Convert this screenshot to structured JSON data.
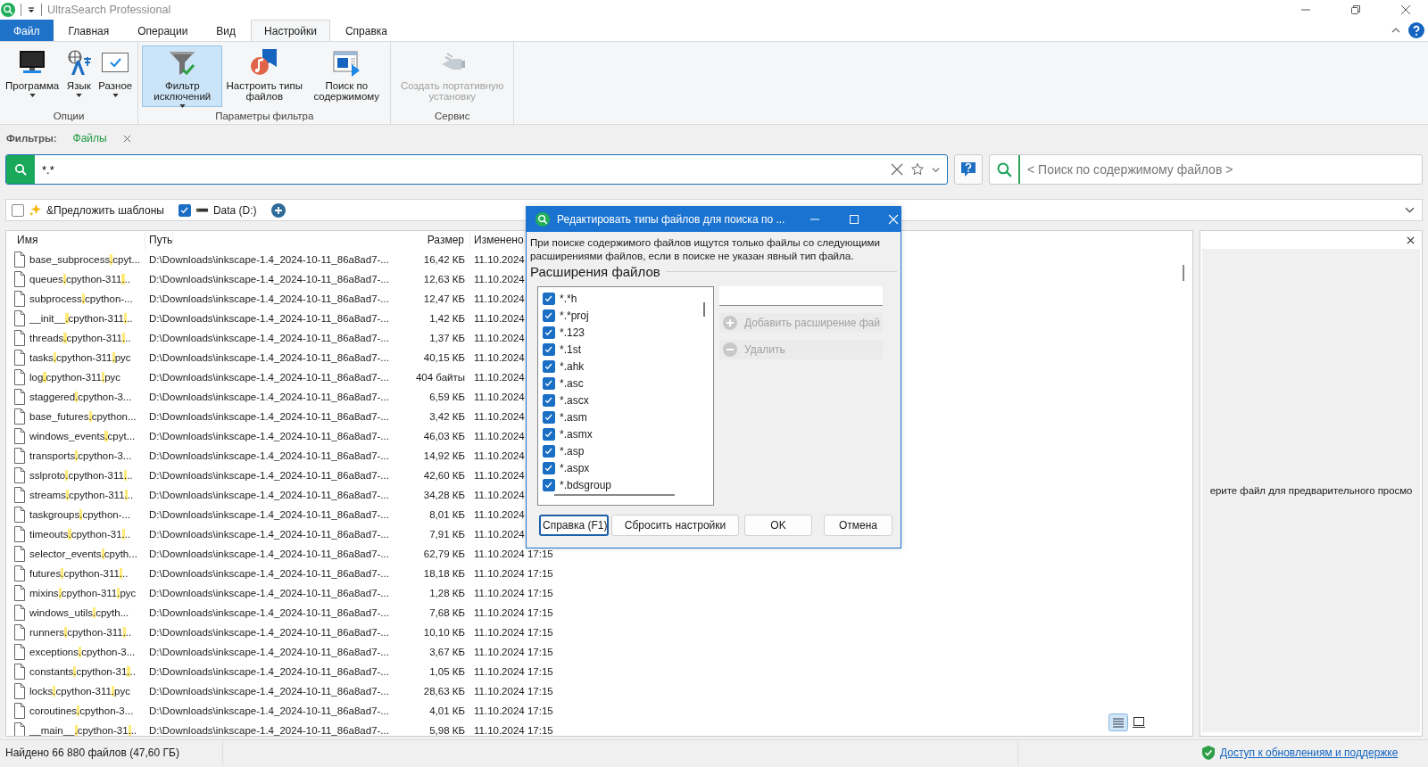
{
  "window": {
    "title": "UltraSearch Professional"
  },
  "ribbon": {
    "tabs": [
      {
        "label": "Файл",
        "kind": "file",
        "selected": false
      },
      {
        "label": "Главная",
        "kind": "tab",
        "selected": false
      },
      {
        "label": "Операции",
        "kind": "tab",
        "selected": false
      },
      {
        "label": "Вид",
        "kind": "tab",
        "selected": false
      },
      {
        "label": "Настройки",
        "kind": "tab",
        "selected": true
      },
      {
        "label": "Справка",
        "kind": "tab",
        "selected": false
      }
    ],
    "groups": [
      {
        "label": "Опции",
        "buttons": [
          {
            "label": "Программа",
            "kind": "monitor",
            "dropdown": true,
            "pressed": false,
            "disabled": false
          },
          {
            "label": "Язык",
            "kind": "language",
            "dropdown": true,
            "pressed": false,
            "disabled": false
          },
          {
            "label": "Разное",
            "kind": "checkwindow",
            "dropdown": true,
            "pressed": false,
            "disabled": false
          }
        ]
      },
      {
        "label": "Параметры фильтра",
        "buttons": [
          {
            "label": "Фильтр исключений",
            "kind": "funnel",
            "dropdown": true,
            "pressed": true,
            "disabled": false
          },
          {
            "label": "Настроить типы файлов",
            "kind": "music",
            "dropdown": false,
            "pressed": false,
            "disabled": false
          },
          {
            "label": "Поиск по содержимому",
            "kind": "content",
            "dropdown": false,
            "pressed": false,
            "disabled": false
          }
        ]
      },
      {
        "label": "Сервис",
        "buttons": [
          {
            "label": "Создать портативную установку",
            "kind": "usb",
            "dropdown": false,
            "pressed": false,
            "disabled": true
          }
        ]
      }
    ]
  },
  "filters": {
    "label": "Фильтры:",
    "tabs": [
      {
        "label": "Файлы"
      }
    ]
  },
  "search": {
    "value": "*.*"
  },
  "content_search": {
    "placeholder": "< Поиск по содержимому файлов >"
  },
  "options": [
    {
      "label": "&Предложить шаблоны",
      "kind": "sparkle",
      "checked": false
    },
    {
      "label": "Data (D:)",
      "kind": "drive",
      "checked": true
    }
  ],
  "table": {
    "columns": [
      "Имя",
      "Путь",
      "Размер",
      "Изменено"
    ],
    "rows": [
      {
        "name": [
          {
            "text": "base_subprocess",
            "match": false
          },
          {
            "text": ".",
            "match": true
          },
          {
            "text": "cpyt...",
            "match": false
          }
        ],
        "path": "D:\\Downloads\\inkscape-1.4_2024-10-11_86a8ad7-...",
        "size": "16,42 КБ",
        "modified": "11.10.2024"
      },
      {
        "name": [
          {
            "text": "queues",
            "match": false
          },
          {
            "text": ".",
            "match": true
          },
          {
            "text": "cpython-311",
            "match": false
          },
          {
            "text": ".",
            "match": true
          },
          {
            "text": "..",
            "match": false
          }
        ],
        "path": "D:\\Downloads\\inkscape-1.4_2024-10-11_86a8ad7-...",
        "size": "12,63 КБ",
        "modified": "11.10.2024"
      },
      {
        "name": [
          {
            "text": "subprocess",
            "match": false
          },
          {
            "text": ".",
            "match": true
          },
          {
            "text": "cpython-...",
            "match": false
          }
        ],
        "path": "D:\\Downloads\\inkscape-1.4_2024-10-11_86a8ad7-...",
        "size": "12,47 КБ",
        "modified": "11.10.2024"
      },
      {
        "name": [
          {
            "text": "__init__",
            "match": false
          },
          {
            "text": ".",
            "match": true
          },
          {
            "text": "cpython-311",
            "match": false
          },
          {
            "text": ".",
            "match": true
          },
          {
            "text": "..",
            "match": false
          }
        ],
        "path": "D:\\Downloads\\inkscape-1.4_2024-10-11_86a8ad7-...",
        "size": "1,42 КБ",
        "modified": "11.10.2024"
      },
      {
        "name": [
          {
            "text": "threads",
            "match": false
          },
          {
            "text": ".",
            "match": true
          },
          {
            "text": "cpython-311",
            "match": false
          },
          {
            "text": ".",
            "match": true
          },
          {
            "text": "..",
            "match": false
          }
        ],
        "path": "D:\\Downloads\\inkscape-1.4_2024-10-11_86a8ad7-...",
        "size": "1,37 КБ",
        "modified": "11.10.2024"
      },
      {
        "name": [
          {
            "text": "tasks",
            "match": false
          },
          {
            "text": ".",
            "match": true
          },
          {
            "text": "cpython-311",
            "match": false
          },
          {
            "text": ".",
            "match": true
          },
          {
            "text": "pyc",
            "match": false
          }
        ],
        "path": "D:\\Downloads\\inkscape-1.4_2024-10-11_86a8ad7-...",
        "size": "40,15 КБ",
        "modified": "11.10.2024"
      },
      {
        "name": [
          {
            "text": "log",
            "match": false
          },
          {
            "text": ".",
            "match": true
          },
          {
            "text": "cpython-311",
            "match": false
          },
          {
            "text": ".",
            "match": true
          },
          {
            "text": "pyc",
            "match": false
          }
        ],
        "path": "D:\\Downloads\\inkscape-1.4_2024-10-11_86a8ad7-...",
        "size": "404 байты",
        "modified": "11.10.2024"
      },
      {
        "name": [
          {
            "text": "staggered",
            "match": false
          },
          {
            "text": ".",
            "match": true
          },
          {
            "text": "cpython-3...",
            "match": false
          }
        ],
        "path": "D:\\Downloads\\inkscape-1.4_2024-10-11_86a8ad7-...",
        "size": "6,59 КБ",
        "modified": "11.10.2024"
      },
      {
        "name": [
          {
            "text": "base_futures",
            "match": false
          },
          {
            "text": ".",
            "match": true
          },
          {
            "text": "cpython...",
            "match": false
          }
        ],
        "path": "D:\\Downloads\\inkscape-1.4_2024-10-11_86a8ad7-...",
        "size": "3,42 КБ",
        "modified": "11.10.2024"
      },
      {
        "name": [
          {
            "text": "windows_events",
            "match": false
          },
          {
            "text": ".",
            "match": true
          },
          {
            "text": "cpyt...",
            "match": false
          }
        ],
        "path": "D:\\Downloads\\inkscape-1.4_2024-10-11_86a8ad7-...",
        "size": "46,03 КБ",
        "modified": "11.10.2024"
      },
      {
        "name": [
          {
            "text": "transports",
            "match": false
          },
          {
            "text": ".",
            "match": true
          },
          {
            "text": "cpython-3...",
            "match": false
          }
        ],
        "path": "D:\\Downloads\\inkscape-1.4_2024-10-11_86a8ad7-...",
        "size": "14,92 КБ",
        "modified": "11.10.2024"
      },
      {
        "name": [
          {
            "text": "sslproto",
            "match": false
          },
          {
            "text": ".",
            "match": true
          },
          {
            "text": "cpython-311",
            "match": false
          },
          {
            "text": ".",
            "match": true
          },
          {
            "text": "..",
            "match": false
          }
        ],
        "path": "D:\\Downloads\\inkscape-1.4_2024-10-11_86a8ad7-...",
        "size": "42,60 КБ",
        "modified": "11.10.2024"
      },
      {
        "name": [
          {
            "text": "streams",
            "match": false
          },
          {
            "text": ".",
            "match": true
          },
          {
            "text": "cpython-311",
            "match": false
          },
          {
            "text": ".",
            "match": true
          },
          {
            "text": "..",
            "match": false
          }
        ],
        "path": "D:\\Downloads\\inkscape-1.4_2024-10-11_86a8ad7-...",
        "size": "34,28 КБ",
        "modified": "11.10.2024"
      },
      {
        "name": [
          {
            "text": "taskgroups",
            "match": false
          },
          {
            "text": ".",
            "match": true
          },
          {
            "text": "cpython-...",
            "match": false
          }
        ],
        "path": "D:\\Downloads\\inkscape-1.4_2024-10-11_86a8ad7-...",
        "size": "8,01 КБ",
        "modified": "11.10.2024"
      },
      {
        "name": [
          {
            "text": "timeouts",
            "match": false
          },
          {
            "text": ".",
            "match": true
          },
          {
            "text": "cpython-31",
            "match": false
          },
          {
            "text": ".",
            "match": true
          },
          {
            "text": "..",
            "match": false
          }
        ],
        "path": "D:\\Downloads\\inkscape-1.4_2024-10-11_86a8ad7-...",
        "size": "7,91 КБ",
        "modified": "11.10.2024"
      },
      {
        "name": [
          {
            "text": "selector_events",
            "match": false
          },
          {
            "text": ".",
            "match": true
          },
          {
            "text": "cpyth...",
            "match": false
          }
        ],
        "path": "D:\\Downloads\\inkscape-1.4_2024-10-11_86a8ad7-...",
        "size": "62,79 КБ",
        "modified": "11.10.2024 17:15"
      },
      {
        "name": [
          {
            "text": "futures",
            "match": false
          },
          {
            "text": ".",
            "match": true
          },
          {
            "text": "cpython-311",
            "match": false
          },
          {
            "text": ".",
            "match": true
          },
          {
            "text": "..",
            "match": false
          }
        ],
        "path": "D:\\Downloads\\inkscape-1.4_2024-10-11_86a8ad7-...",
        "size": "18,18 КБ",
        "modified": "11.10.2024 17:15"
      },
      {
        "name": [
          {
            "text": "mixins",
            "match": false
          },
          {
            "text": ".",
            "match": true
          },
          {
            "text": "cpython-311",
            "match": false
          },
          {
            "text": ".",
            "match": true
          },
          {
            "text": "pyc",
            "match": false
          }
        ],
        "path": "D:\\Downloads\\inkscape-1.4_2024-10-11_86a8ad7-...",
        "size": "1,28 КБ",
        "modified": "11.10.2024 17:15"
      },
      {
        "name": [
          {
            "text": "windows_utils",
            "match": false
          },
          {
            "text": ".",
            "match": true
          },
          {
            "text": "cpyth...",
            "match": false
          }
        ],
        "path": "D:\\Downloads\\inkscape-1.4_2024-10-11_86a8ad7-...",
        "size": "7,68 КБ",
        "modified": "11.10.2024 17:15"
      },
      {
        "name": [
          {
            "text": "runners",
            "match": false
          },
          {
            "text": ".",
            "match": true
          },
          {
            "text": "cpython-311",
            "match": false
          },
          {
            "text": ".",
            "match": true
          },
          {
            "text": "..",
            "match": false
          }
        ],
        "path": "D:\\Downloads\\inkscape-1.4_2024-10-11_86a8ad7-...",
        "size": "10,10 КБ",
        "modified": "11.10.2024 17:15"
      },
      {
        "name": [
          {
            "text": "exceptions",
            "match": false
          },
          {
            "text": ".",
            "match": true
          },
          {
            "text": "cpython-3...",
            "match": false
          }
        ],
        "path": "D:\\Downloads\\inkscape-1.4_2024-10-11_86a8ad7-...",
        "size": "3,67 КБ",
        "modified": "11.10.2024 17:15"
      },
      {
        "name": [
          {
            "text": "constants",
            "match": false
          },
          {
            "text": ".",
            "match": true
          },
          {
            "text": "cpython-31",
            "match": false
          },
          {
            "text": ".",
            "match": true
          },
          {
            "text": "..",
            "match": false
          }
        ],
        "path": "D:\\Downloads\\inkscape-1.4_2024-10-11_86a8ad7-...",
        "size": "1,05 КБ",
        "modified": "11.10.2024 17:15"
      },
      {
        "name": [
          {
            "text": "locks",
            "match": false
          },
          {
            "text": ".",
            "match": true
          },
          {
            "text": "cpython-311",
            "match": false
          },
          {
            "text": ".",
            "match": true
          },
          {
            "text": "pyc",
            "match": false
          }
        ],
        "path": "D:\\Downloads\\inkscape-1.4_2024-10-11_86a8ad7-...",
        "size": "28,63 КБ",
        "modified": "11.10.2024 17:15"
      },
      {
        "name": [
          {
            "text": "coroutines",
            "match": false
          },
          {
            "text": ".",
            "match": true
          },
          {
            "text": "cpython-3...",
            "match": false
          }
        ],
        "path": "D:\\Downloads\\inkscape-1.4_2024-10-11_86a8ad7-...",
        "size": "4,01 КБ",
        "modified": "11.10.2024 17:15"
      },
      {
        "name": [
          {
            "text": "__main__",
            "match": false
          },
          {
            "text": ".",
            "match": true
          },
          {
            "text": "cpython-31",
            "match": false
          },
          {
            "text": ".",
            "match": true
          },
          {
            "text": "..",
            "match": false
          }
        ],
        "path": "D:\\Downloads\\inkscape-1.4_2024-10-11_86a8ad7-...",
        "size": "5,98 КБ",
        "modified": "11.10.2024 17:15"
      }
    ]
  },
  "preview": {
    "message": "ерите файл для предварительного просмо"
  },
  "status_bar": {
    "found": "Найдено 66 880 файлов (47,60 ГБ)",
    "link": "Доступ к обновлениям и поддержке"
  },
  "dialog": {
    "title": "Редактировать типы файлов для поиска по ...",
    "description": "При поиске содержимого файлов ищутся только файлы со следующими расширениями файлов, если в поиске не указан явный тип файла.",
    "section": "Расширения файлов",
    "extensions": [
      {
        "label": "*.*h",
        "checked": true
      },
      {
        "label": "*.*proj",
        "checked": true
      },
      {
        "label": "*.123",
        "checked": true
      },
      {
        "label": "*.1st",
        "checked": true
      },
      {
        "label": "*.ahk",
        "checked": true
      },
      {
        "label": "*.asc",
        "checked": true
      },
      {
        "label": "*.ascx",
        "checked": true
      },
      {
        "label": "*.asm",
        "checked": true
      },
      {
        "label": "*.asmx",
        "checked": true
      },
      {
        "label": "*.asp",
        "checked": true
      },
      {
        "label": "*.aspx",
        "checked": true
      },
      {
        "label": "*.bdsgroup",
        "checked": true
      }
    ],
    "actions": [
      {
        "label": "Добавить расширение фай",
        "kind": "add",
        "disabled": true
      },
      {
        "label": "Удалить",
        "kind": "remove",
        "disabled": true
      }
    ],
    "buttons": [
      {
        "label": "Справка (F1)",
        "focused": true
      },
      {
        "label": "Сбросить настройки",
        "focused": false
      },
      {
        "label": "OK",
        "focused": false
      },
      {
        "label": "Отмена",
        "focused": false
      }
    ]
  }
}
